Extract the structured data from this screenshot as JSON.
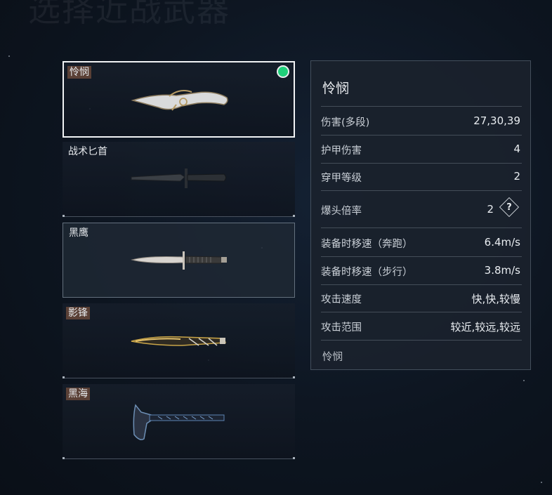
{
  "background_title": "选择近战武器",
  "weapons": [
    {
      "name": "怜悯",
      "tagged": true,
      "equipped": true,
      "icon": "karambit-knife-icon"
    },
    {
      "name": "战术匕首",
      "tagged": false,
      "equipped": false,
      "icon": "tactical-dagger-icon"
    },
    {
      "name": "黑鹰",
      "tagged": false,
      "equipped": false,
      "icon": "black-eagle-knife-icon"
    },
    {
      "name": "影锋",
      "tagged": true,
      "equipped": false,
      "icon": "shadow-blade-icon"
    },
    {
      "name": "黑海",
      "tagged": true,
      "equipped": false,
      "icon": "tomahawk-axe-icon"
    }
  ],
  "stats": {
    "title": "怜悯",
    "rows": [
      {
        "label": "伤害(多段)",
        "value": "27,30,39"
      },
      {
        "label": "护甲伤害",
        "value": "4"
      },
      {
        "label": "穿甲等级",
        "value": "2"
      },
      {
        "label": "爆头倍率",
        "value": "2",
        "help": "?"
      },
      {
        "label": "装备时移速（奔跑）",
        "value": "6.4m/s"
      },
      {
        "label": "装备时移速（步行）",
        "value": "3.8m/s"
      },
      {
        "label": "攻击速度",
        "value": "快,快,较慢"
      },
      {
        "label": "攻击范围",
        "value": "较近,较远,较远"
      }
    ],
    "description": "怜悯"
  },
  "colors": {
    "equipped_dot": "#1fd07a",
    "name_tag": "#5a4036",
    "selected_border": "#f1f3f5"
  }
}
